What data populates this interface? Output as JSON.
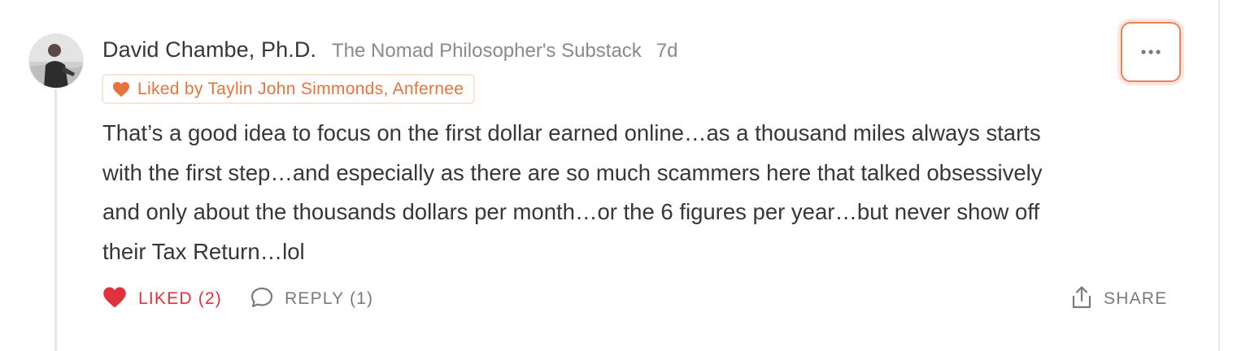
{
  "comment": {
    "author": "David Chambe, Ph.D.",
    "publication": "The Nomad Philosopher's Substack",
    "time_ago": "7d",
    "liked_by": "Liked by Taylin John Simmonds, Anfernee",
    "body_lines": [
      "That’s a good idea to focus on the first dollar earned online…as a thousand miles always starts",
      "with the first step…and especially as there are so much scammers here that talked obsessively",
      "and only about the thousands dollars per month…or the 6 figures per year…but never show off",
      "their Tax Return…lol"
    ]
  },
  "actions": {
    "like_label": "LIKED (2)",
    "reply_label": "REPLY (1)",
    "share_label": "SHARE"
  },
  "icons": {
    "heart": "heart-icon",
    "reply": "speech-bubble-icon",
    "share": "share-icon",
    "more": "ellipsis-icon"
  },
  "colors": {
    "accent": "#e8723c",
    "liked": "#e2303c",
    "muted": "#8a8a8a",
    "text": "#363737"
  }
}
